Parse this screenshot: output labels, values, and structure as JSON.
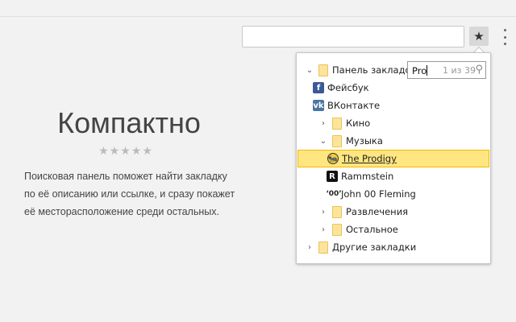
{
  "toolbar": {
    "star_icon": "★",
    "menu_icon": "vertical-dots"
  },
  "hero": {
    "title": "Компактно",
    "rating": "★★★★★",
    "description_lines": [
      "Поисковая панель поможет найти закладку",
      "по её описанию или ссылке, и сразу покажет",
      "её месторасположение среди остальных."
    ]
  },
  "popup": {
    "search": {
      "value": "Pro",
      "count": "1 из 39",
      "icon": "⚲"
    },
    "items": [
      {
        "label": "Панель закладок",
        "type": "folder",
        "level": 0,
        "expanded": true
      },
      {
        "label": "Фейсбук",
        "type": "facebook",
        "level": 1
      },
      {
        "label": "ВКонтакте",
        "type": "vk",
        "level": 1
      },
      {
        "label": "Кино",
        "type": "folder",
        "level": 1,
        "expanded": false
      },
      {
        "label": "Музыка",
        "type": "folder",
        "level": 1,
        "expanded": true
      },
      {
        "label": "The Prodigy",
        "type": "prodigy",
        "level": 2,
        "selected": true
      },
      {
        "label": "Rammstein",
        "type": "rammstein",
        "level": 2
      },
      {
        "label": "John 00 Fleming",
        "type": "jof",
        "level": 2
      },
      {
        "label": "Развлечения",
        "type": "folder",
        "level": 1,
        "expanded": false
      },
      {
        "label": "Остальное",
        "type": "folder",
        "level": 1,
        "expanded": false
      },
      {
        "label": "Другие закладки",
        "type": "folder",
        "level": 0,
        "expanded": false
      }
    ]
  },
  "colors": {
    "highlight": "#ffe680",
    "highlight_border": "#f5b800",
    "facebook": "#3b5998",
    "vk": "#4c75a3"
  }
}
